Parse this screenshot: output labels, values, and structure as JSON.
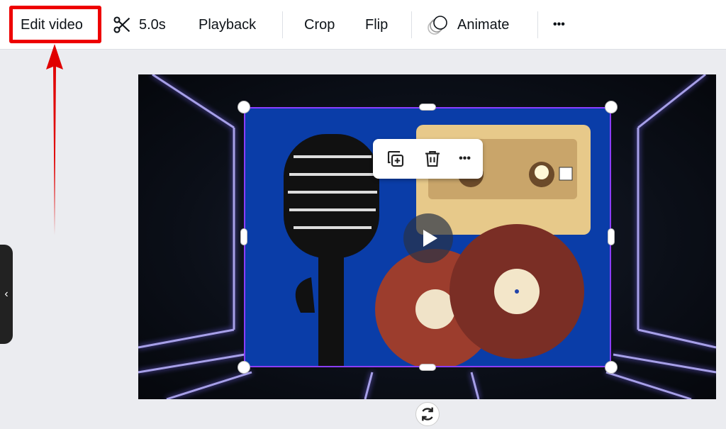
{
  "toolbar": {
    "edit_video": "Edit video",
    "duration": "5.0s",
    "playback": "Playback",
    "crop": "Crop",
    "flip": "Flip",
    "animate": "Animate",
    "more": "•••"
  },
  "context_menu": {
    "more": "•••"
  },
  "annotation": {
    "color": "#e00000"
  },
  "colors": {
    "selection": "#8b3dff",
    "clip_background": "#0a3da8"
  },
  "side_tab": {
    "icon": "‹"
  }
}
